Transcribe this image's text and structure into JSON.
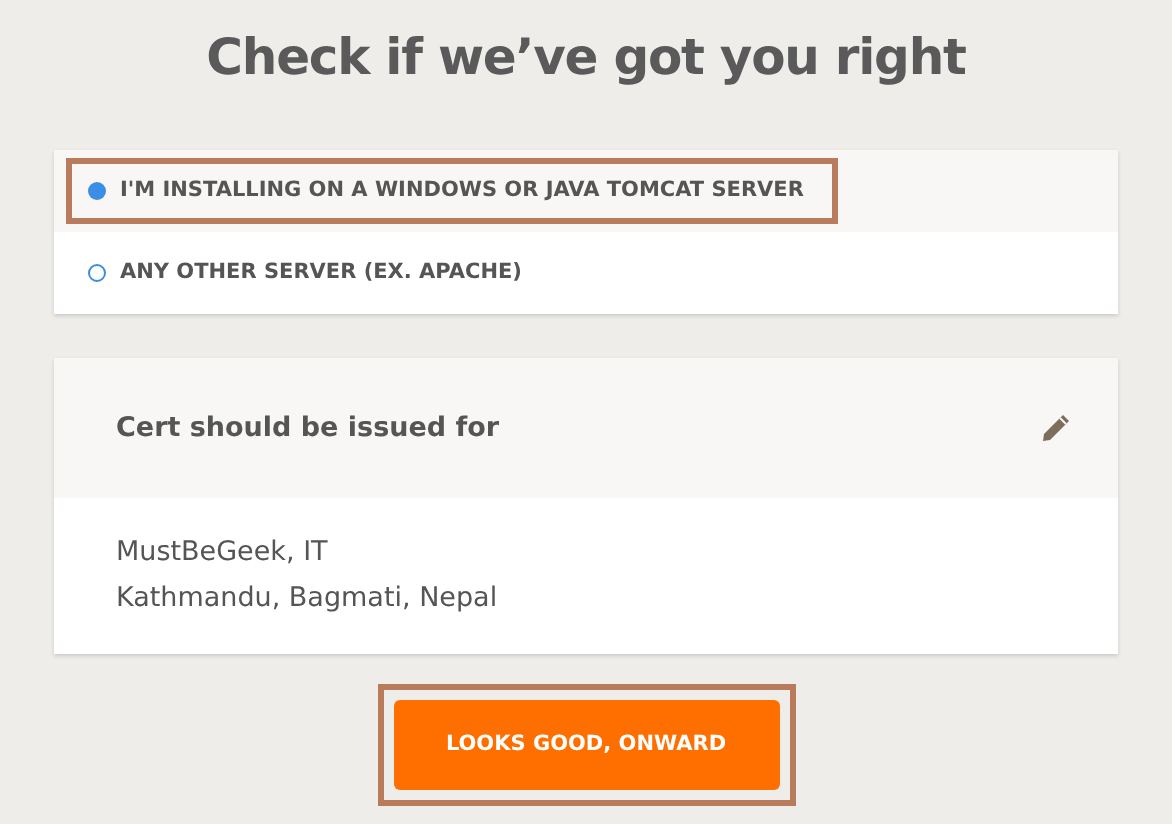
{
  "title": "Check if we’ve got you right",
  "server_options": [
    {
      "label": "I'M INSTALLING ON A WINDOWS OR JAVA TOMCAT SERVER",
      "selected": true,
      "highlighted": true
    },
    {
      "label": "ANY OTHER SERVER (EX. APACHE)",
      "selected": false,
      "highlighted": false
    }
  ],
  "cert_card": {
    "heading": "Cert should be issued for",
    "lines": [
      "MustBeGeek, IT",
      "Kathmandu, Bagmati, Nepal"
    ]
  },
  "button": {
    "label": "LOOKS GOOD, ONWARD",
    "highlighted": true
  }
}
